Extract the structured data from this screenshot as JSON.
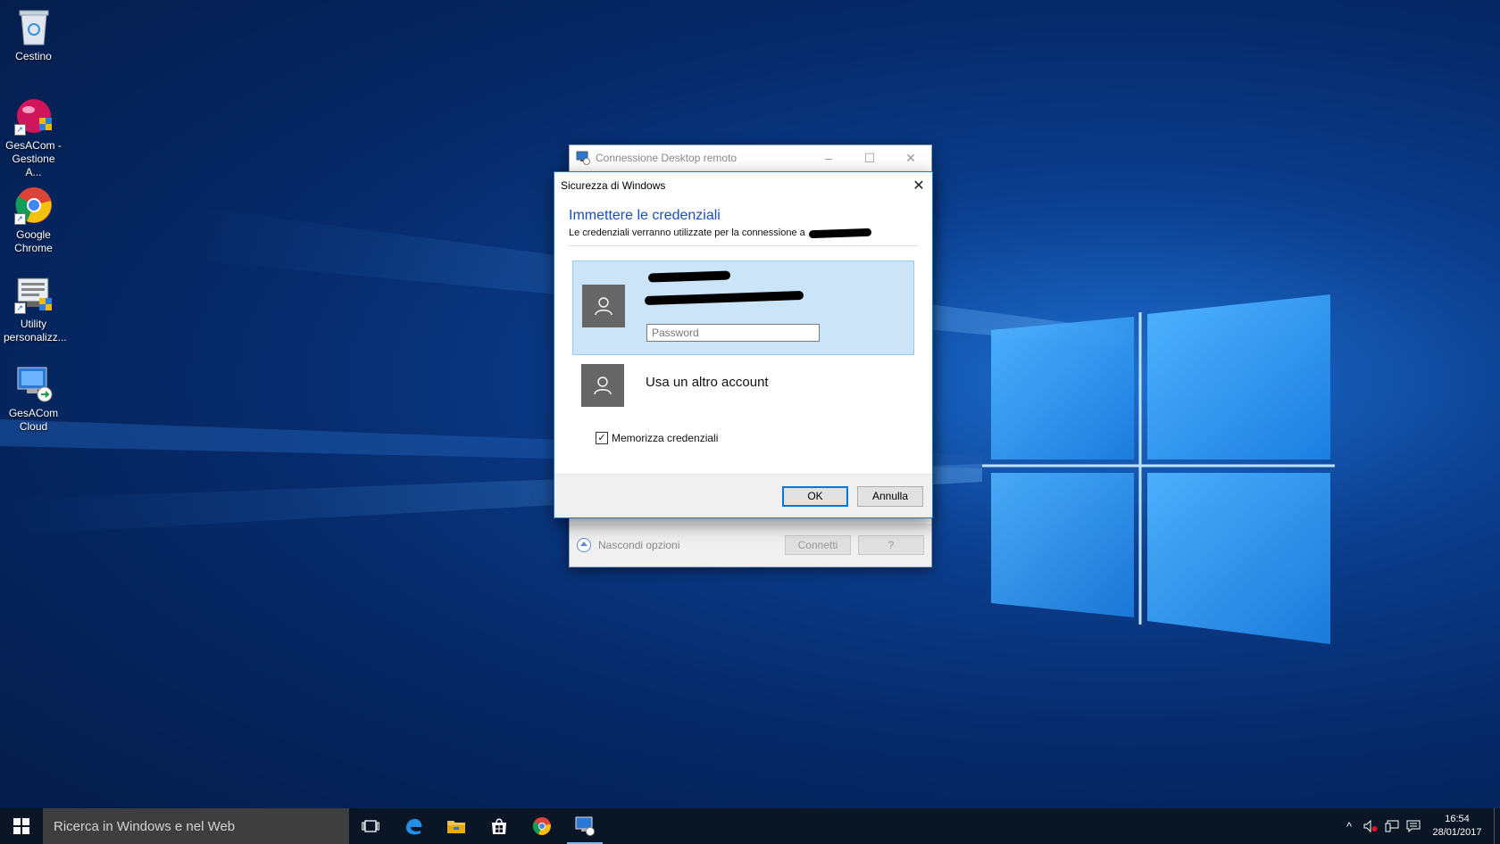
{
  "desktop": {
    "icons": [
      {
        "label": "Cestino",
        "icon": "recycle-bin-icon"
      },
      {
        "label": "GesACom - Gestione A...",
        "icon": "gesacom-icon"
      },
      {
        "label": "Google Chrome",
        "icon": "chrome-icon"
      },
      {
        "label": "Utility personalizz...",
        "icon": "utility-icon"
      },
      {
        "label": "GesACom Cloud",
        "icon": "remote-desktop-icon"
      }
    ]
  },
  "rdp_window": {
    "title": "Connessione Desktop remoto",
    "minimize": "–",
    "maximize": "☐",
    "close": "✕",
    "options_label": "Nascondi opzioni",
    "connect_label": "Connetti",
    "help_label": "?"
  },
  "security_dialog": {
    "title": "Sicurezza di Windows",
    "close": "✕",
    "heading": "Immettere le credenziali",
    "subtitle": "Le credenziali verranno utilizzate per la connessione a",
    "password_placeholder": "Password",
    "other_account_label": "Usa un altro account",
    "remember_label": "Memorizza credenziali",
    "remember_checked": true,
    "ok_label": "OK",
    "cancel_label": "Annulla",
    "accent_color": "#0078d7"
  },
  "taskbar": {
    "search_placeholder": "Ricerca in Windows e nel Web",
    "apps": [
      "task-view-icon",
      "edge-icon",
      "file-explorer-icon",
      "store-icon",
      "chrome-icon",
      "remote-desktop-icon"
    ],
    "clock_time": "16:54",
    "clock_date": "28/01/2017"
  }
}
